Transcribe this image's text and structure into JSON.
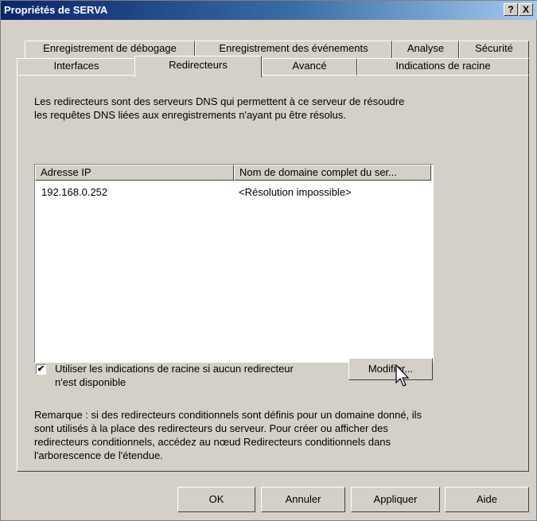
{
  "window": {
    "title": "Propriétés de SERVA",
    "help_button": "?",
    "close_button": "X"
  },
  "tabs_row1": [
    "Enregistrement de débogage",
    "Enregistrement des événements",
    "Analyse",
    "Sécurité"
  ],
  "tabs_row2": [
    "Interfaces",
    "Redirecteurs",
    "Avancé",
    "Indications de racine"
  ],
  "active_tab": "Redirecteurs",
  "description": "Les redirecteurs sont des serveurs DNS qui permettent à ce serveur de résoudre les requêtes DNS liées aux enregistrements n'ayant pu être résolus.",
  "forwarders_list": {
    "columns": [
      "Adresse IP",
      "Nom de domaine complet du ser..."
    ],
    "rows": [
      {
        "ip": "192.168.0.252",
        "fqdn": "<Résolution impossible>"
      }
    ]
  },
  "use_root_hints": {
    "checked": true,
    "label_line1": "Utiliser les indications de racine si aucun redirecteur",
    "label_line2": "n'est disponible"
  },
  "modify_button": "Modifier...",
  "note": "Remarque : si des redirecteurs conditionnels sont définis pour un domaine donné, ils sont utilisés à la place des redirecteurs du serveur. Pour créer ou afficher des redirecteurs conditionnels, accédez au nœud Redirecteurs conditionnels dans l'arborescence de l'étendue.",
  "footer": {
    "ok": "OK",
    "cancel": "Annuler",
    "apply": "Appliquer",
    "help": "Aide"
  }
}
